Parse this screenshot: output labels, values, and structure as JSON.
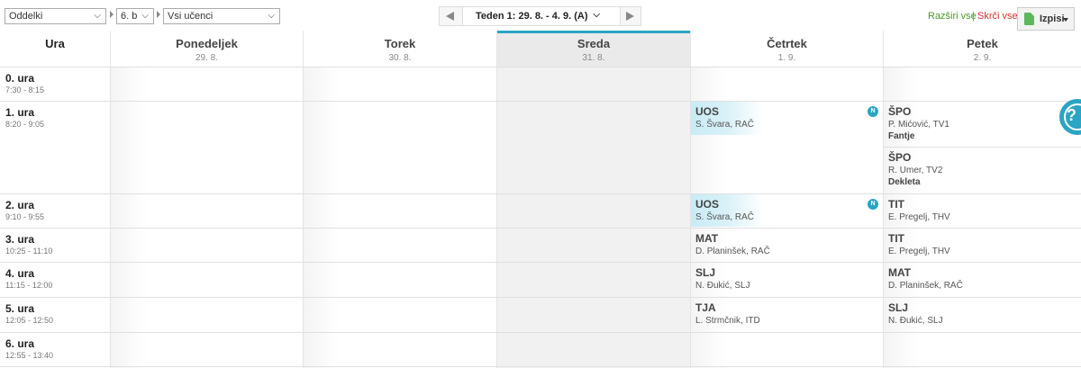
{
  "toolbar": {
    "oddelki_label": "Oddelki",
    "class_value": "6. b",
    "students_value": "Vsi učenci",
    "week_label": "Teden 1: 29. 8. - 4. 9. (A)",
    "expand_all": "Razširi vse",
    "separator": "|",
    "collapse_all": "Skrči vse",
    "print_label": "Izpisi"
  },
  "header": {
    "ura_label": "Ura",
    "days": [
      {
        "name": "Ponedeljek",
        "date": "29. 8."
      },
      {
        "name": "Torek",
        "date": "30. 8."
      },
      {
        "name": "Sreda",
        "date": "31. 8."
      },
      {
        "name": "Četrtek",
        "date": "1. 9."
      },
      {
        "name": "Petek",
        "date": "2. 9."
      }
    ]
  },
  "periods": [
    {
      "name": "0. ura",
      "time": "7:30 - 8:15"
    },
    {
      "name": "1. ura",
      "time": "8:20 - 9:05"
    },
    {
      "name": "2. ura",
      "time": "9:10 - 9:55"
    },
    {
      "name": "3. ura",
      "time": "10:25 - 11:10"
    },
    {
      "name": "4. ura",
      "time": "11:15 - 12:00"
    },
    {
      "name": "5. ura",
      "time": "12:05 - 12:50"
    },
    {
      "name": "6. ura",
      "time": "12:55 - 13:40"
    }
  ],
  "lessons": {
    "thu_1": {
      "subject": "UOS",
      "teacher": "S. Švara, RAČ",
      "badge": "N"
    },
    "fri_1a": {
      "subject": "ŠPO",
      "teacher": "P. Mićović, TV1",
      "group": "Fantje"
    },
    "fri_1b": {
      "subject": "ŠPO",
      "teacher": "R. Umer, TV2",
      "group": "Dekleta"
    },
    "thu_2": {
      "subject": "UOS",
      "teacher": "S. Švara, RAČ",
      "badge": "N"
    },
    "fri_2": {
      "subject": "TIT",
      "teacher": "E. Pregelj, THV"
    },
    "thu_3": {
      "subject": "MAT",
      "teacher": "D. Planinšek, RAČ"
    },
    "fri_3": {
      "subject": "TIT",
      "teacher": "E. Pregelj, THV"
    },
    "thu_4": {
      "subject": "SLJ",
      "teacher": "N. Đukić, SLJ"
    },
    "fri_4": {
      "subject": "MAT",
      "teacher": "D. Planinšek, RAČ"
    },
    "thu_5": {
      "subject": "TJA",
      "teacher": "L. Strmčnik, ITD"
    },
    "fri_5": {
      "subject": "SLJ",
      "teacher": "N. Đukić, SLJ"
    }
  },
  "help": {
    "symbol": "?"
  },
  "colors": {
    "accent": "#2aa5c3",
    "expand": "#4a9a2a",
    "collapse": "#d03030",
    "highlight": "#c9ebf5"
  }
}
